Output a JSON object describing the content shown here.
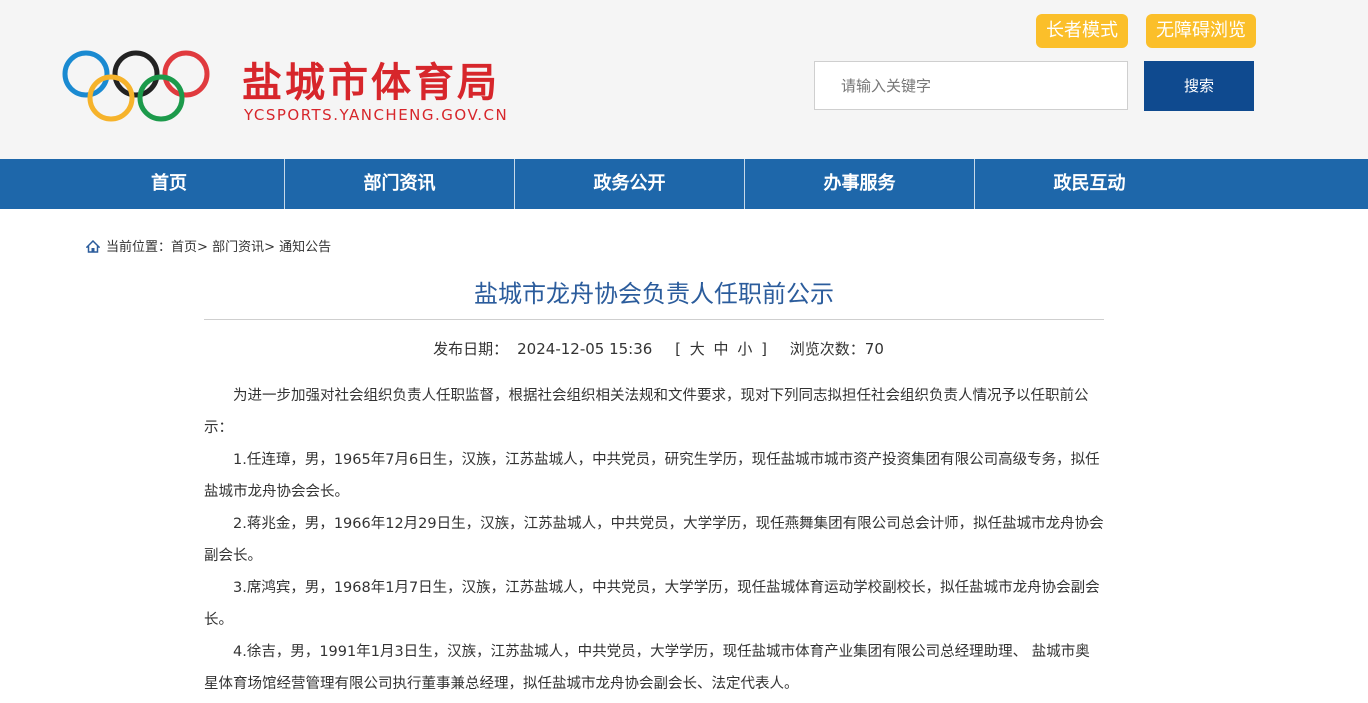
{
  "header": {
    "site_title": "盐城市体育局",
    "site_domain": "YCSPORTS.YANCHENG.GOV.CN",
    "elder_mode_label": "长者模式",
    "barrier_free_label": "无障碍浏览",
    "search_placeholder": "请输入关键字",
    "search_button_label": "搜索"
  },
  "nav": {
    "items": [
      "首页",
      "部门资讯",
      "政务公开",
      "办事服务",
      "政民互动"
    ]
  },
  "breadcrumb": {
    "prefix": "当前位置：",
    "items": [
      "首页",
      "部门资讯",
      "通知公告"
    ],
    "separator": ">"
  },
  "article": {
    "title": "盐城市龙舟协会负责人任职前公示",
    "publish_label": "发布日期：",
    "publish_date": "2024-12-05 15:36",
    "font_size_controls": {
      "open": "[",
      "large": "大",
      "medium": "中",
      "small": "小",
      "close": "]"
    },
    "views_label": "浏览次数：",
    "views": "70",
    "paragraphs": [
      "为进一步加强对社会组织负责人任职监督，根据社会组织相关法规和文件要求，现对下列同志拟担任社会组织负责人情况予以任职前公示：",
      "1.任连璋，男，1965年7月6日生，汉族，江苏盐城人，中共党员，研究生学历，现任盐城市城市资产投资集团有限公司高级专务，拟任盐城市龙舟协会会长。",
      "2.蒋兆金，男，1966年12月29日生，汉族，江苏盐城人，中共党员，大学学历，现任燕舞集团有限公司总会计师，拟任盐城市龙舟协会副会长。",
      "3.席鸿宾，男，1968年1月7日生，汉族，江苏盐城人，中共党员，大学学历，现任盐城体育运动学校副校长，拟任盐城市龙舟协会副会长。",
      "4.徐吉，男，1991年1月3日生，汉族，江苏盐城人，中共党员，大学学历，现任盐城市体育产业集团有限公司总经理助理、 盐城市奥星体育场馆经营管理有限公司执行董事兼总经理，拟任盐城市龙舟协会副会长、法定代表人。"
    ]
  },
  "colors": {
    "brand_red": "#d7262b",
    "nav_blue": "#1e67aa",
    "search_blue": "#0f4a8f",
    "accent_yellow": "#fbbf2a",
    "title_blue": "#2b5c9c"
  }
}
